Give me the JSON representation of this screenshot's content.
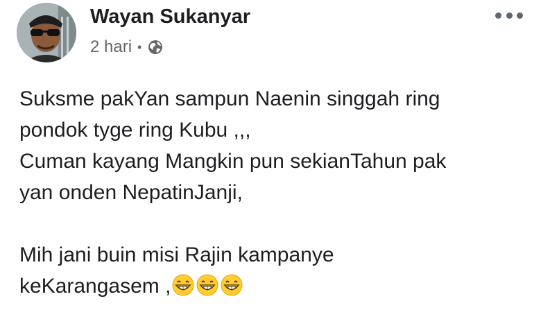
{
  "post": {
    "author": "Wayan Sukanyar",
    "time": "2 hari",
    "separator": "•",
    "privacy_icon": "globe-icon",
    "menu_icon": "more-options-icon",
    "lines": [
      "Suksme pakYan sampun Naenin singgah ring",
      "pondok tyge ring Kubu ,,,",
      "Cuman kayang Mangkin pun sekianTahun pak",
      "yan onden NepatinJanji,"
    ],
    "last_lines": [
      "Mih jani buin misi Rajin kampanye",
      "keKarangasem ,"
    ],
    "emoji": [
      "grinning-face-emoji",
      "grinning-face-emoji",
      "grinning-face-emoji"
    ]
  },
  "colors": {
    "text": "#1c1e21",
    "secondary": "#65676b",
    "emoji_yellow": "#ffcc33"
  }
}
